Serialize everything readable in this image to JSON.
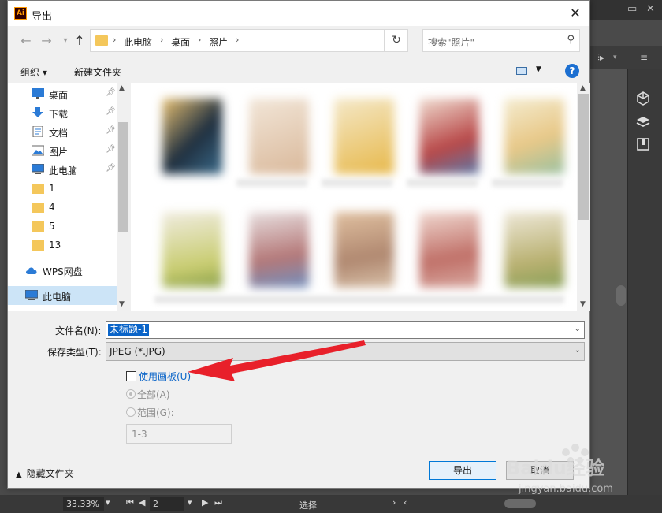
{
  "dialog": {
    "title": "导出",
    "app_icon_text": "Ai",
    "close_glyph": "✕"
  },
  "address": {
    "breadcrumbs": [
      "此电脑",
      "桌面",
      "照片"
    ],
    "search_placeholder": "搜索\"照片\""
  },
  "toolbar": {
    "organize": "组织 ▾",
    "new_folder": "新建文件夹",
    "help": "?"
  },
  "nav": {
    "items": [
      {
        "label": "桌面",
        "icon": "desktop-icon",
        "pinned": true
      },
      {
        "label": "下载",
        "icon": "download-icon",
        "pinned": true
      },
      {
        "label": "文档",
        "icon": "document-icon",
        "pinned": true
      },
      {
        "label": "图片",
        "icon": "picture-icon",
        "pinned": true
      },
      {
        "label": "此电脑",
        "icon": "computer-icon",
        "pinned": true
      },
      {
        "label": "1",
        "icon": "folder-icon",
        "pinned": false
      },
      {
        "label": "4",
        "icon": "folder-icon",
        "pinned": false
      },
      {
        "label": "5",
        "icon": "folder-icon",
        "pinned": false
      },
      {
        "label": "13",
        "icon": "folder-icon",
        "pinned": false
      },
      {
        "label": "WPS网盘",
        "icon": "cloud-icon",
        "pinned": false
      },
      {
        "label": "此电脑",
        "icon": "computer-icon",
        "pinned": false,
        "selected": true
      }
    ]
  },
  "form": {
    "filename_label": "文件名(N):",
    "filename_value": "未标题-1",
    "type_label": "保存类型(T):",
    "type_value": "JPEG (*.JPG)",
    "use_artboard_label": "使用画板(U)",
    "all_label": "全部(A)",
    "range_label": "范围(G):",
    "range_value": "1-3"
  },
  "footer": {
    "hide_folders": "隐藏文件夹",
    "export_button": "导出",
    "cancel_button": "取消"
  },
  "status_bar": {
    "zoom": "33.33%",
    "page": "2",
    "mode": "选择"
  },
  "watermark": {
    "brand": "Baidu经验",
    "url": "jingyan.baidu.com"
  },
  "colors": {
    "accent": "#0078d7",
    "selection": "#0a64c8",
    "nav_selected": "#cce4f7",
    "arrow": "#e8202a"
  }
}
